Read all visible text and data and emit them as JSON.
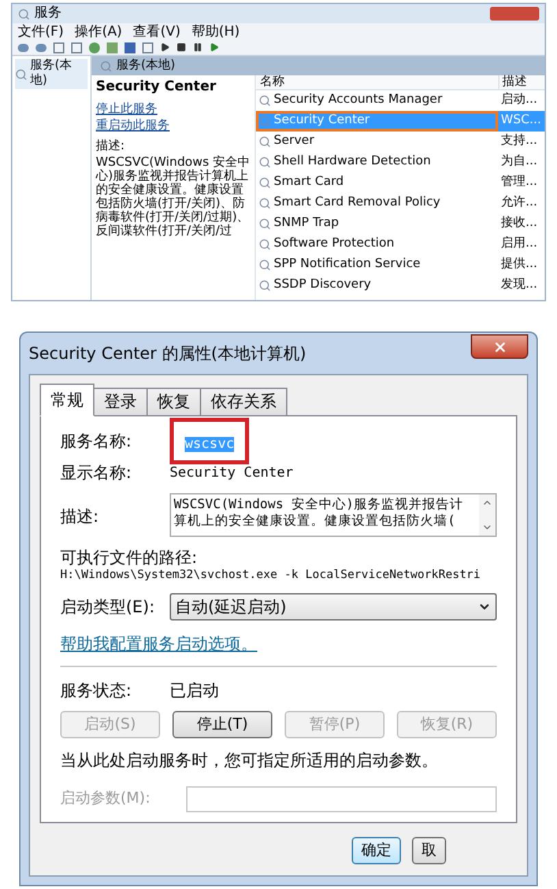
{
  "services_window": {
    "title": "服务",
    "menu": [
      "文件(F)",
      "操作(A)",
      "查看(V)",
      "帮助(H)"
    ],
    "tree": {
      "items": [
        {
          "label": "服务(本地)",
          "selected": true
        }
      ]
    },
    "header": "服务(本地)",
    "detail": {
      "name": "Security Center",
      "links": [
        "停止此服务",
        "重启动此服务"
      ],
      "description_label": "描述:",
      "description": "WSCSVC(Windows 安全中心)服务监视并报告计算机上的安全健康设置。健康设置包括防火墙(打开/关闭)、防病毒软件(打开/关闭/过期)、反间谍软件(打开/关闭/过"
    },
    "table": {
      "columns": [
        "名称",
        "描述"
      ],
      "rows": [
        {
          "name": "Security Accounts Manager",
          "description": "启动...",
          "selected": false
        },
        {
          "name": "Security Center",
          "description": "WSC...",
          "selected": true
        },
        {
          "name": "Server",
          "description": "支持...",
          "selected": false
        },
        {
          "name": "Shell Hardware Detection",
          "description": "为自...",
          "selected": false
        },
        {
          "name": "Smart Card",
          "description": "管理...",
          "selected": false
        },
        {
          "name": "Smart Card Removal Policy",
          "description": "允许...",
          "selected": false
        },
        {
          "name": "SNMP Trap",
          "description": "接收...",
          "selected": false
        },
        {
          "name": "Software Protection",
          "description": "启用...",
          "selected": false
        },
        {
          "name": "SPP Notification Service",
          "description": "提供...",
          "selected": false
        },
        {
          "name": "SSDP Discovery",
          "description": "发现...",
          "selected": false
        }
      ]
    }
  },
  "dialog": {
    "title": "Security Center 的属性(本地计算机)",
    "tabs": [
      {
        "label": "常规",
        "selected": true
      },
      {
        "label": "登录",
        "selected": false
      },
      {
        "label": "恢复",
        "selected": false
      },
      {
        "label": "依存关系",
        "selected": false
      }
    ],
    "service_name": {
      "label": "服务名称:",
      "value": "wscsvc"
    },
    "display_name": {
      "label": "显示名称:",
      "value": "Security Center"
    },
    "description": {
      "label": "描述:",
      "value": "WSCSVC(Windows 安全中心)服务监视并报告计算机上的安全健康设置。健康设置包括防火墙("
    },
    "path": {
      "label": "可执行文件的路径:",
      "value": "H:\\Windows\\System32\\svchost.exe -k LocalServiceNetworkRestri"
    },
    "startup_type": {
      "label": "启动类型(E):",
      "value": "自动(延迟启动)"
    },
    "help_link": "帮助我配置服务启动选项。",
    "status": {
      "label": "服务状态:",
      "value": "已启动"
    },
    "service_buttons": [
      {
        "label": "启动(S)",
        "disabled": true
      },
      {
        "label": "停止(T)",
        "disabled": false
      },
      {
        "label": "暂停(P)",
        "disabled": true
      },
      {
        "label": "恢复(R)",
        "disabled": true
      }
    ],
    "note": "当从此处启动服务时，您可指定所适用的启动参数。",
    "parameters": {
      "label": "启动参数(M):",
      "disabled": true
    },
    "footer_buttons": [
      {
        "label": "确定",
        "default": true
      },
      {
        "label": "取",
        "default": false
      }
    ]
  }
}
